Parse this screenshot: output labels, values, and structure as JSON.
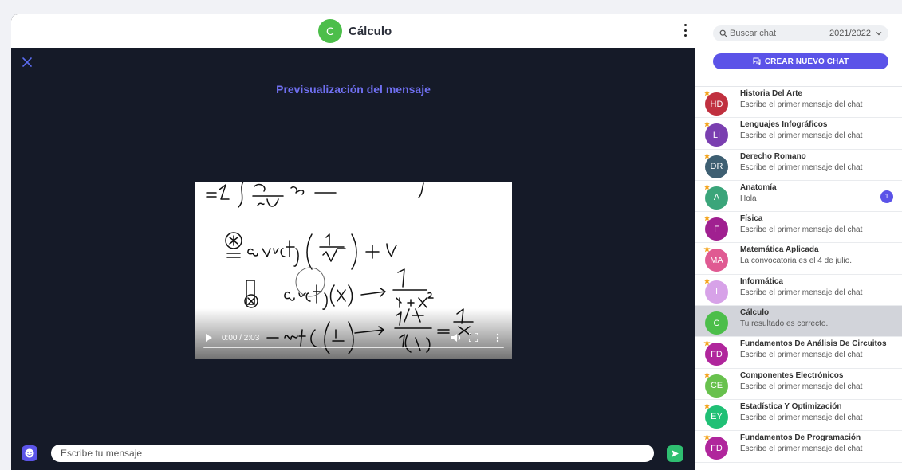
{
  "chat": {
    "title": "Cálculo",
    "avatar_initial": "C",
    "avatar_color": "#4cbe4a",
    "preview_title": "Previsualización del mensaje",
    "input_placeholder": "Escribe tu mensaje"
  },
  "video": {
    "time": "0:00 / 2:03",
    "progress": 0
  },
  "sidebar": {
    "search_placeholder": "Buscar chat",
    "year": "2021/2022",
    "new_chat_label": "CREAR NUEVO CHAT",
    "items": [
      {
        "initials": "HD",
        "name": "Historia Del Arte",
        "last": "Escribe el primer mensaje del chat",
        "color": "#c0303f",
        "starred": true,
        "active": false,
        "unread": ""
      },
      {
        "initials": "LI",
        "name": "Lenguajes Infográficos",
        "last": "Escribe el primer mensaje del chat",
        "color": "#7a3fb0",
        "starred": true,
        "active": false,
        "unread": ""
      },
      {
        "initials": "DR",
        "name": "Derecho Romano",
        "last": "Escribe el primer mensaje del chat",
        "color": "#3e5f72",
        "starred": true,
        "active": false,
        "unread": ""
      },
      {
        "initials": "A",
        "name": "Anatomía",
        "last": "Hola",
        "color": "#3ba57a",
        "starred": true,
        "active": false,
        "unread": "1"
      },
      {
        "initials": "F",
        "name": "Física",
        "last": "Escribe el primer mensaje del chat",
        "color": "#a02090",
        "starred": true,
        "active": false,
        "unread": ""
      },
      {
        "initials": "MA",
        "name": "Matemática Aplicada",
        "last": "La convocatoria es el 4 de julio.",
        "color": "#e05a92",
        "starred": true,
        "active": false,
        "unread": ""
      },
      {
        "initials": "I",
        "name": "Informática",
        "last": "Escribe el primer mensaje del chat",
        "color": "#d7a2e8",
        "starred": true,
        "active": false,
        "unread": ""
      },
      {
        "initials": "C",
        "name": "Cálculo",
        "last": "Tu resultado es correcto.",
        "color": "#4cbe4a",
        "starred": false,
        "active": true,
        "unread": ""
      },
      {
        "initials": "FD",
        "name": "Fundamentos De Análisis De Circuitos",
        "last": "Escribe el primer mensaje del chat",
        "color": "#b0269c",
        "starred": true,
        "active": false,
        "unread": ""
      },
      {
        "initials": "CE",
        "name": "Componentes Electrónicos",
        "last": "Escribe el primer mensaje del chat",
        "color": "#68c14d",
        "starred": true,
        "active": false,
        "unread": ""
      },
      {
        "initials": "EY",
        "name": "Estadística Y Optimización",
        "last": "Escribe el primer mensaje del chat",
        "color": "#20c075",
        "starred": true,
        "active": false,
        "unread": ""
      },
      {
        "initials": "FD",
        "name": "Fundamentos De Programación",
        "last": "Escribe el primer mensaje del chat",
        "color": "#b0269c",
        "starred": true,
        "active": false,
        "unread": ""
      }
    ]
  },
  "colors": {
    "accent": "#5b53e8",
    "send": "#2fbf71",
    "chat_bg": "#151a28",
    "preview_title": "#6f6ff0",
    "star": "#f4a623"
  }
}
